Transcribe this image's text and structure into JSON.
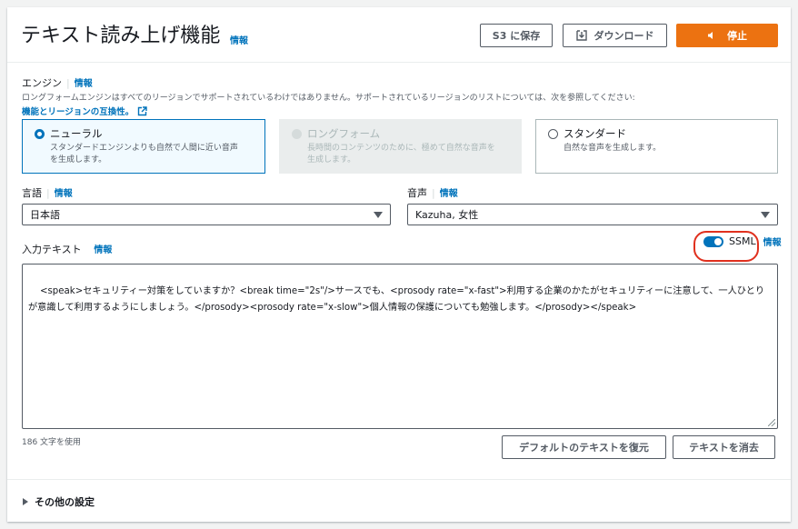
{
  "header": {
    "title": "テキスト読み上げ機能",
    "info": "情報",
    "save_s3": "S3 に保存",
    "download": "ダウンロード",
    "stop": "停止"
  },
  "engine": {
    "label": "エンジン",
    "info": "情報",
    "description": "ロングフォームエンジンはすべてのリージョンでサポートされているわけではありません。サポートされているリージョンのリストについては、次を参照してください:",
    "link": "機能とリージョンの互換性。",
    "options": [
      {
        "title": "ニューラル",
        "desc1": "スタンダードエンジンよりも自然で人間に近い音声",
        "desc2": "を生成します。",
        "state": "selected"
      },
      {
        "title": "ロングフォーム",
        "desc1": "長時間のコンテンツのために、極めて自然な音声を",
        "desc2": "生成します。",
        "state": "disabled"
      },
      {
        "title": "スタンダード",
        "desc1": "自然な音声を生成します。",
        "desc2": "",
        "state": "unselected"
      }
    ]
  },
  "language": {
    "label": "言語",
    "info": "情報",
    "value": "日本語"
  },
  "voice": {
    "label": "音声",
    "info": "情報",
    "value": "Kazuha, 女性"
  },
  "input": {
    "label": "入力テキスト",
    "info": "情報",
    "ssml_label": "SSML",
    "ssml_info": "情報",
    "ssml_enabled": true,
    "text": "<speak>セキュリティー対策をしていますか？<break time=\"2s\"/>サースでも、<prosody rate=\"x-fast\">利用する企業のかたがセキュリティーに注意して、一人ひとりが意識して利用するようにしましょう。</prosody><prosody rate=\"x-slow\">個人情報の保護についても勉強します。</prosody></speak>",
    "char_count": "186 文字を使用",
    "restore_default": "デフォルトのテキストを復元",
    "clear_text": "テキストを消去"
  },
  "other_settings": {
    "label": "その他の設定"
  },
  "colors": {
    "accent": "#0073bb",
    "primary": "#ec7211",
    "highlight": "#e0301e"
  }
}
